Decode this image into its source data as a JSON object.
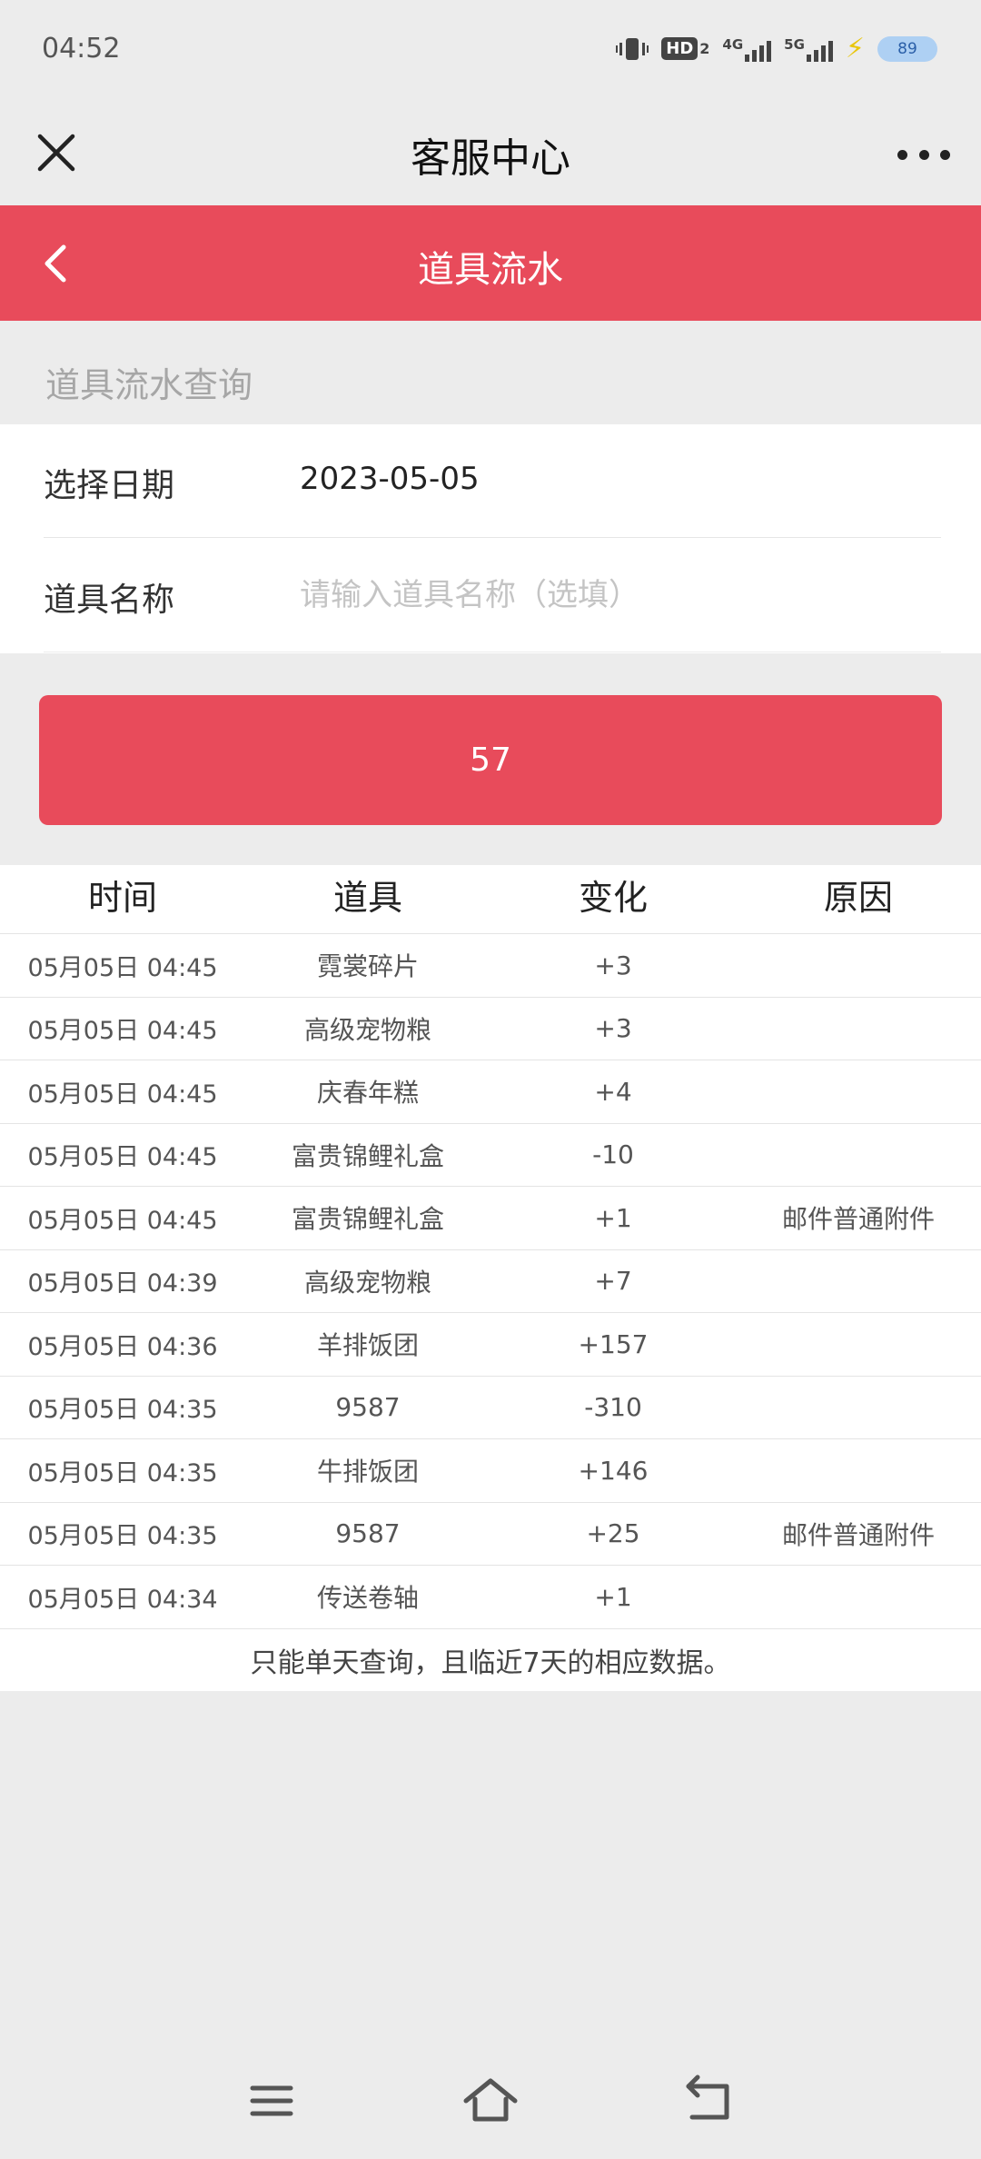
{
  "status_bar": {
    "time": "04:52",
    "network_1": "4G",
    "network_2": "5G",
    "hd_label": "HD",
    "hd_sub": "2",
    "battery": "89"
  },
  "title_bar": {
    "title": "客服中心"
  },
  "header": {
    "title": "道具流水"
  },
  "query": {
    "section_label": "道具流水查询",
    "date_label": "选择日期",
    "date_value": "2023-05-05",
    "item_label": "道具名称",
    "item_placeholder": "请输入道具名称（选填）",
    "submit_label": "57"
  },
  "table": {
    "headers": [
      "时间",
      "道具",
      "变化",
      "原因"
    ],
    "rows": [
      {
        "time": "05月05日 04:45",
        "item": "霓裳碎片",
        "change": "+3",
        "reason": ""
      },
      {
        "time": "05月05日 04:45",
        "item": "高级宠物粮",
        "change": "+3",
        "reason": ""
      },
      {
        "time": "05月05日 04:45",
        "item": "庆春年糕",
        "change": "+4",
        "reason": ""
      },
      {
        "time": "05月05日 04:45",
        "item": "富贵锦鲤礼盒",
        "change": "-10",
        "reason": ""
      },
      {
        "time": "05月05日 04:45",
        "item": "富贵锦鲤礼盒",
        "change": "+1",
        "reason": "邮件普通附件"
      },
      {
        "time": "05月05日 04:39",
        "item": "高级宠物粮",
        "change": "+7",
        "reason": ""
      },
      {
        "time": "05月05日 04:36",
        "item": "羊排饭团",
        "change": "+157",
        "reason": ""
      },
      {
        "time": "05月05日 04:35",
        "item": "9587",
        "change": "-310",
        "reason": ""
      },
      {
        "time": "05月05日 04:35",
        "item": "牛排饭团",
        "change": "+146",
        "reason": ""
      },
      {
        "time": "05月05日 04:35",
        "item": "9587",
        "change": "+25",
        "reason": "邮件普通附件"
      },
      {
        "time": "05月05日 04:34",
        "item": "传送卷轴",
        "change": "+1",
        "reason": ""
      }
    ],
    "note": "只能单天查询，且临近7天的相应数据。"
  },
  "colors": {
    "accent": "#e84b5b",
    "background": "#ececec"
  },
  "icons": {
    "close": "close-icon",
    "more": "more-icon",
    "back": "chevron-left-icon",
    "nav_menu": "menu-icon",
    "nav_home": "home-icon",
    "nav_back": "back-icon"
  }
}
